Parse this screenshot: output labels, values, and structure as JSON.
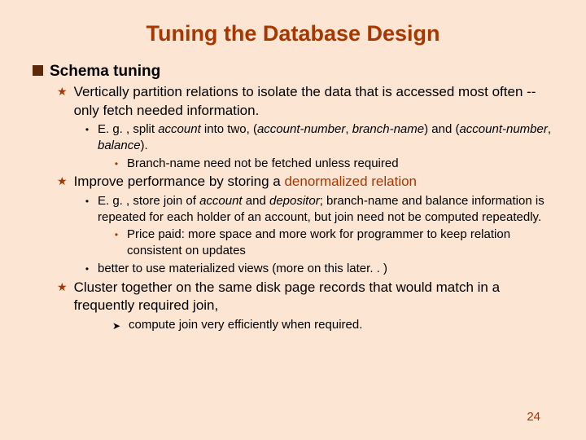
{
  "title": "Tuning the Database Design",
  "page_number": "24",
  "lvl0": {
    "text": "Schema tuning"
  },
  "lvl1a": {
    "pre": "Vertically partition relations to isolate the data that is accessed most often -- only fetch needed information."
  },
  "lvl2a": {
    "p1": "E. g. , split  ",
    "acct": "account",
    "p2": " into two, (",
    "an": "account-number",
    "p3": ", ",
    "bn": "branch-name",
    "p4": ") and (",
    "an2": "account-number",
    "p5": ", ",
    "bal": "balance",
    "p6": ")."
  },
  "lvl3a": {
    "text": "Branch-name need not be fetched unless required"
  },
  "lvl1b": {
    "p1": "Improve performance by storing a ",
    "emph": "denormalized relation"
  },
  "lvl2b": {
    "p1": "E. g. , store join of  ",
    "acct": "account",
    "p2": " and  ",
    "dep": "depositor",
    "p3": "; branch-name and balance information is repeated for each holder of  an account, but join need not be computed repeatedly."
  },
  "lvl3b": {
    "text": "Price paid:  more space and more work for programmer to keep relation consistent on updates"
  },
  "lvl2c": {
    "text": "better to use materialized views (more on this later. . )"
  },
  "lvl1c": {
    "text": "Cluster together on the same disk page records that would match in a frequently required join,"
  },
  "lvl3c": {
    "text": "compute join very efficiently when required."
  }
}
